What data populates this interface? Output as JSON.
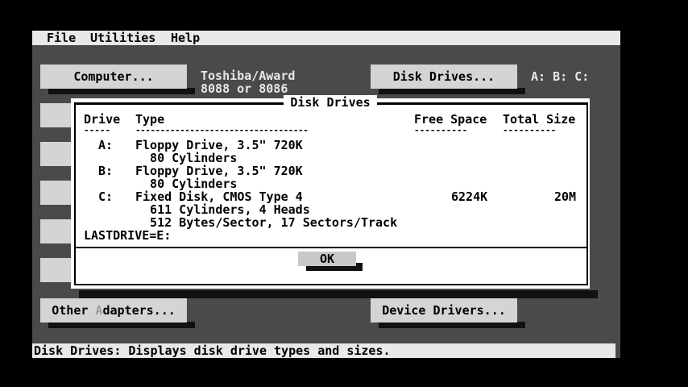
{
  "menu": [
    "File",
    "Utilities",
    "Help"
  ],
  "left_buttons": {
    "computer": "Computer...",
    "other_adapters_prefix": "Other ",
    "other_adapters_hot": "A",
    "other_adapters_rest": "dapters..."
  },
  "right_buttons": {
    "disk_drives": "Disk Drives...",
    "device_drivers": "Device Drivers..."
  },
  "computer_info": [
    "Toshiba/Award",
    "8088 or 8086"
  ],
  "disk_info": "A: B: C:",
  "status": "Disk Drives: Displays disk drive types and sizes.",
  "dialog": {
    "title": "Disk Drives",
    "headers": {
      "drive": "Drive",
      "type": "Type",
      "free": "Free Space",
      "total": "Total Size"
    },
    "underlines": {
      "drive": "-----",
      "type": "-----------------------------------",
      "free": "----------",
      "total": "----------"
    },
    "rows": [
      {
        "drive": "A:",
        "lines": [
          "Floppy Drive, 3.5\" 720K",
          "  80 Cylinders"
        ],
        "free": "",
        "total": ""
      },
      {
        "drive": "B:",
        "lines": [
          "Floppy Drive, 3.5\" 720K",
          "  80 Cylinders"
        ],
        "free": "",
        "total": ""
      },
      {
        "drive": "C:",
        "lines": [
          "Fixed Disk, CMOS Type 4",
          "  611 Cylinders, 4 Heads",
          "  512 Bytes/Sector, 17 Sectors/Track"
        ],
        "free": "6224K",
        "total": "20M"
      }
    ],
    "lastdrive": "LASTDRIVE=E:",
    "ok": "OK"
  }
}
